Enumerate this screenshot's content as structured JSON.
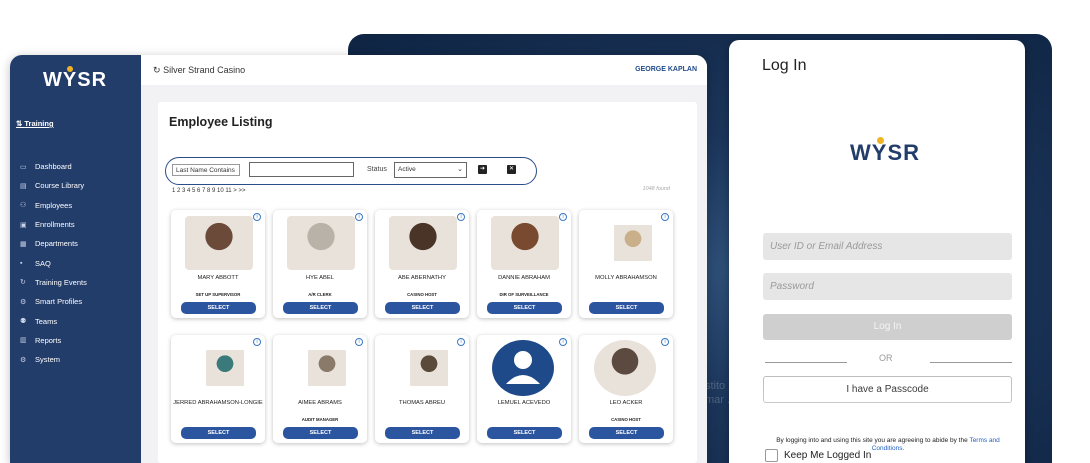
{
  "app": {
    "logo": "WYSR",
    "casino_name": "Silver Strand Casino",
    "user_name": "GEORGE KAPLAN"
  },
  "sidebar": {
    "section": "Training",
    "items": [
      {
        "label": "Dashboard",
        "icon": "dashboard-icon"
      },
      {
        "label": "Course Library",
        "icon": "library-icon"
      },
      {
        "label": "Employees",
        "icon": "employees-icon"
      },
      {
        "label": "Enrollments",
        "icon": "enrollments-icon"
      },
      {
        "label": "Departments",
        "icon": "departments-icon"
      },
      {
        "label": "SAQ",
        "icon": "saq-icon"
      },
      {
        "label": "Training Events",
        "icon": "events-icon"
      },
      {
        "label": "Smart Profiles",
        "icon": "profiles-icon"
      },
      {
        "label": "Teams",
        "icon": "teams-icon"
      },
      {
        "label": "Reports",
        "icon": "reports-icon"
      },
      {
        "label": "System",
        "icon": "system-icon"
      }
    ]
  },
  "listing": {
    "title": "Employee Listing",
    "filter_label": "Last Name Contains",
    "filter_value": "",
    "status_label": "Status",
    "status_value": "Active",
    "pager": "1 2 3 4 5 6 7 8 9 10 11 > >>",
    "found": "1048 found",
    "select_label": "SELECT",
    "employees": [
      {
        "name": "MARY ABBOTT",
        "role": "SET UP SUPERVISOR",
        "photo": "#6b4a3a"
      },
      {
        "name": "HYE ABEL",
        "role": "A/R CLERK",
        "photo": "#b9b2a8"
      },
      {
        "name": "ABE ABERNATHY",
        "role": "CASINO HOST",
        "photo": "#4a3428"
      },
      {
        "name": "DANNIE ABRAHAM",
        "role": "DIR OF SURVEILLANCE",
        "photo": "#7a4a30"
      },
      {
        "name": "MOLLY ABRAHAMSON",
        "role": "",
        "photo": "#c9b08a"
      },
      {
        "name": "JERRED ABRAHAMSON-LONGIE",
        "role": "",
        "photo": "#3b7a7a"
      },
      {
        "name": "AIMEE ABRAMS",
        "role": "AUDIT MANAGER",
        "photo": "#8a7a6a"
      },
      {
        "name": "THOMAS ABREU",
        "role": "",
        "photo": "#5a4a3a"
      },
      {
        "name": "LEMUEL ACEVEDO",
        "role": "",
        "photo": "#1f4a8a"
      },
      {
        "name": "LEO ACKER",
        "role": "CASINO HOST",
        "photo": "#5c4a40"
      }
    ]
  },
  "login": {
    "title": "Log In",
    "logo": "WYSR",
    "user_placeholder": "User ID or Email Address",
    "password_placeholder": "Password",
    "login_button": "Log In",
    "or": "OR",
    "passcode_button": "I have a Passcode",
    "terms_text": "By logging into and using this site you are agreeing to abide by the",
    "terms_link": "Terms and Conditions.",
    "keep_logged_in": "Keep Me Logged In"
  },
  "backdrop": {
    "fragment_1": "stito",
    "fragment_2": "mar ."
  }
}
